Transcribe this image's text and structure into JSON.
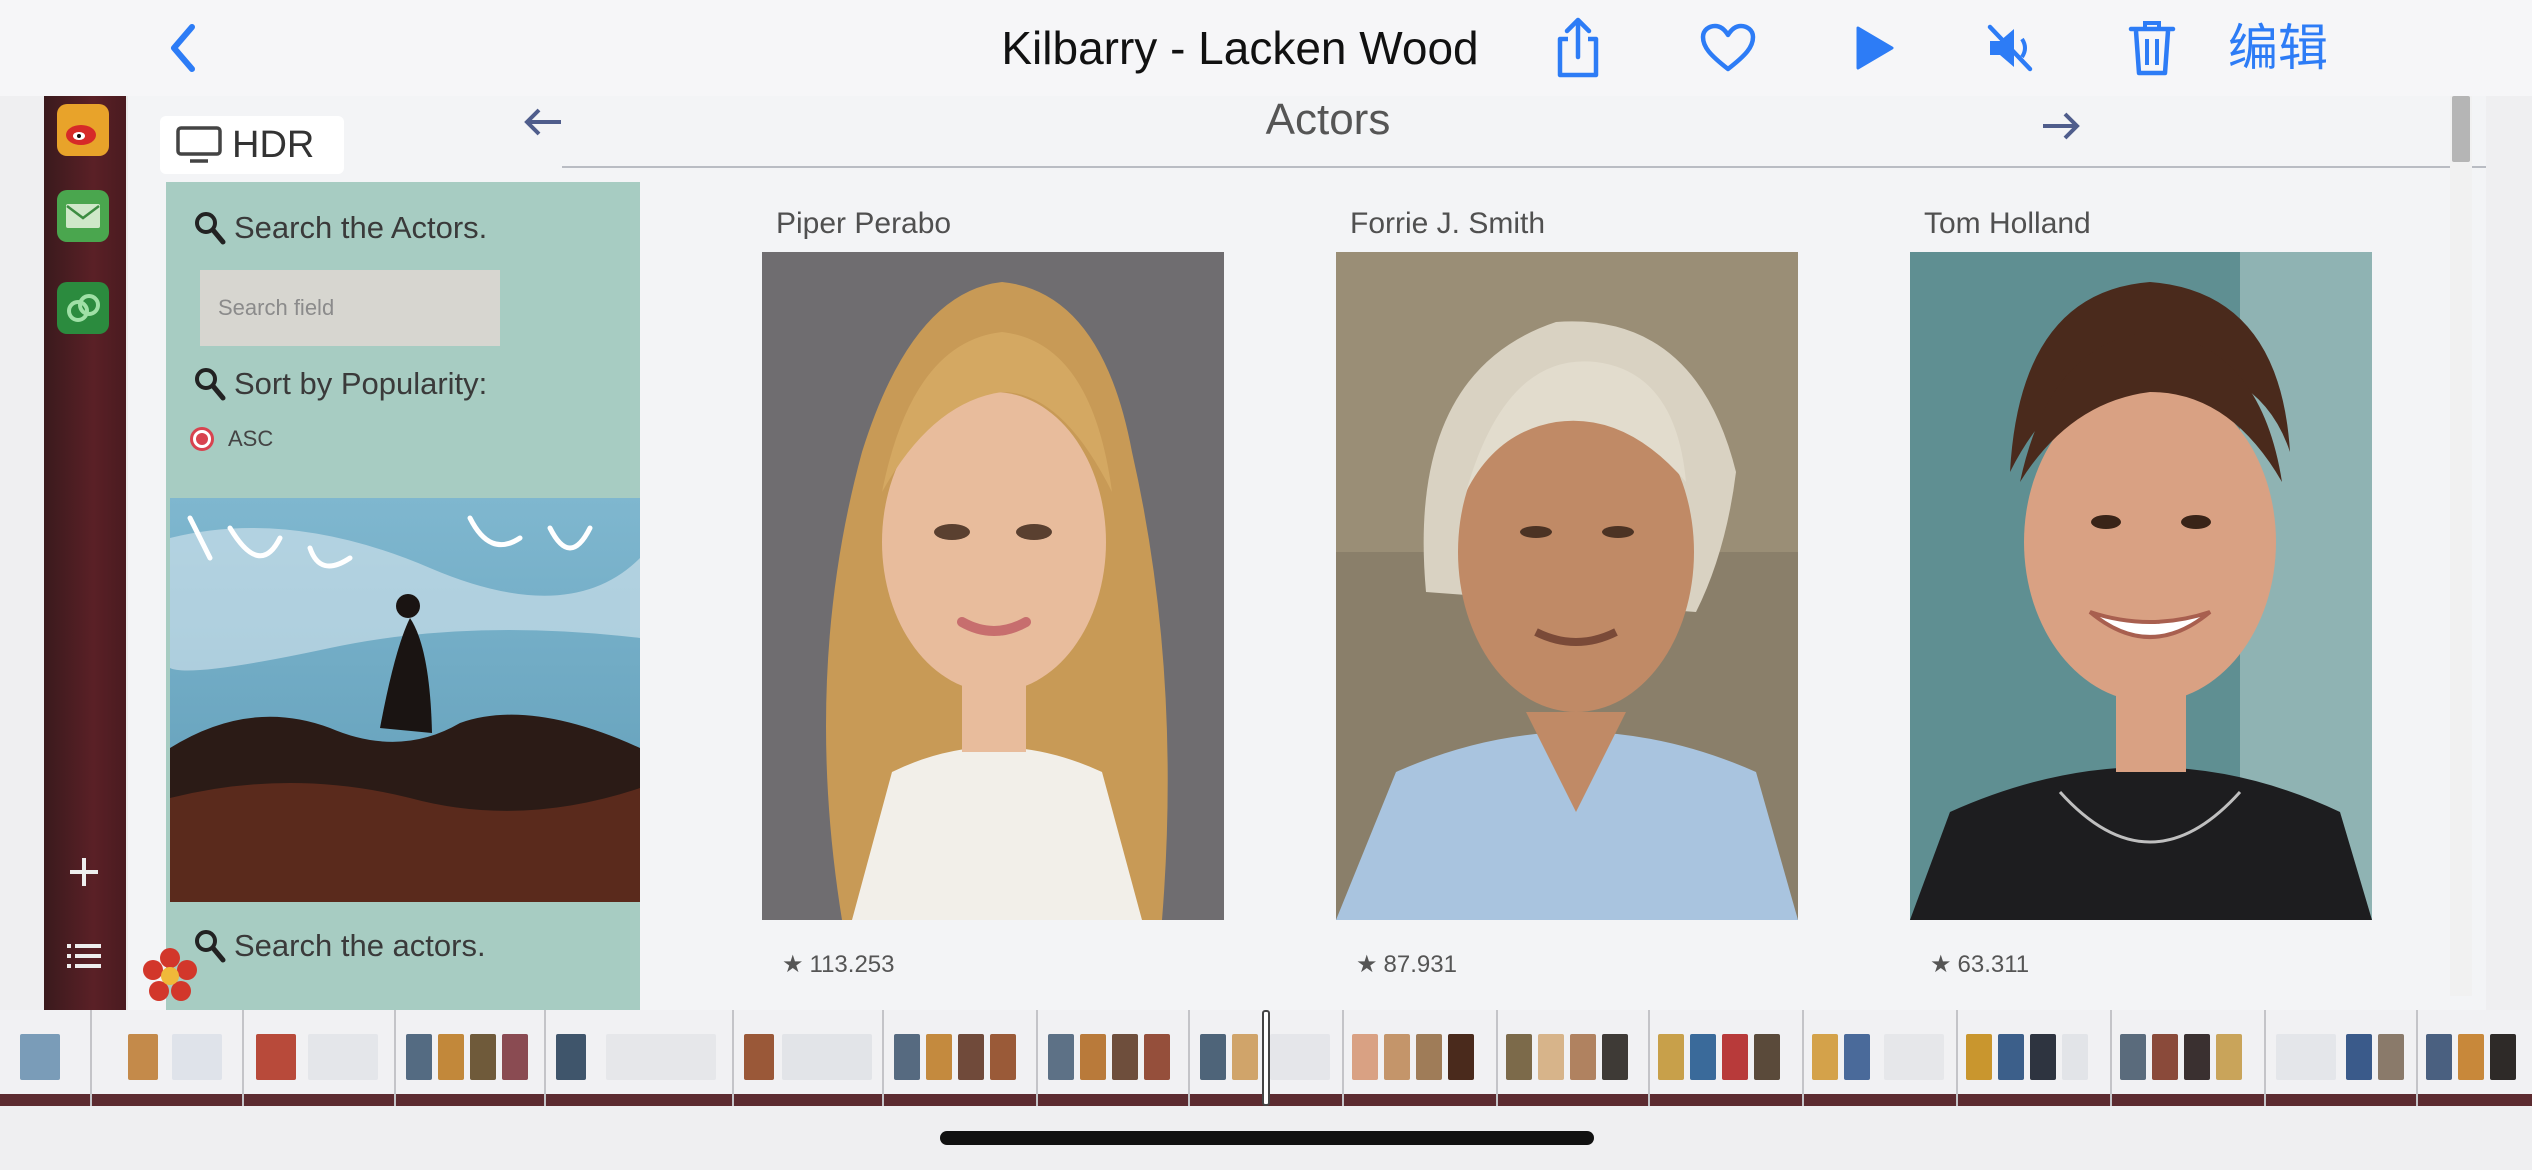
{
  "viewer": {
    "title": "Kilbarry - Lacken Wood",
    "edit_label": "编辑",
    "accent_color": "#2d7cf6",
    "buttons": [
      "back-icon",
      "share-icon",
      "heart-icon",
      "play-icon",
      "mute-icon",
      "trash-icon"
    ]
  },
  "screen": {
    "hdr_label": "HDR",
    "heading": "Actors",
    "dock_items": [
      "weibo-icon",
      "mail-icon",
      "cloud-icon",
      "plus-icon",
      "list-icon"
    ],
    "sidebar": {
      "search_label": "Search the Actors.",
      "search_placeholder": "Search field",
      "sort_label": "Sort by Popularity:",
      "sort_option": "ASC",
      "search_label_2": "Search the actors."
    },
    "actors": [
      {
        "name": "Piper Perabo",
        "popularity": "113.253"
      },
      {
        "name": "Forrie J. Smith",
        "popularity": "87.931"
      },
      {
        "name": "Tom Holland",
        "popularity": "63.311"
      }
    ]
  },
  "colors": {
    "sidebar": "#a7ccc2",
    "dock": "#5a2026",
    "radio": "#d8434f"
  }
}
